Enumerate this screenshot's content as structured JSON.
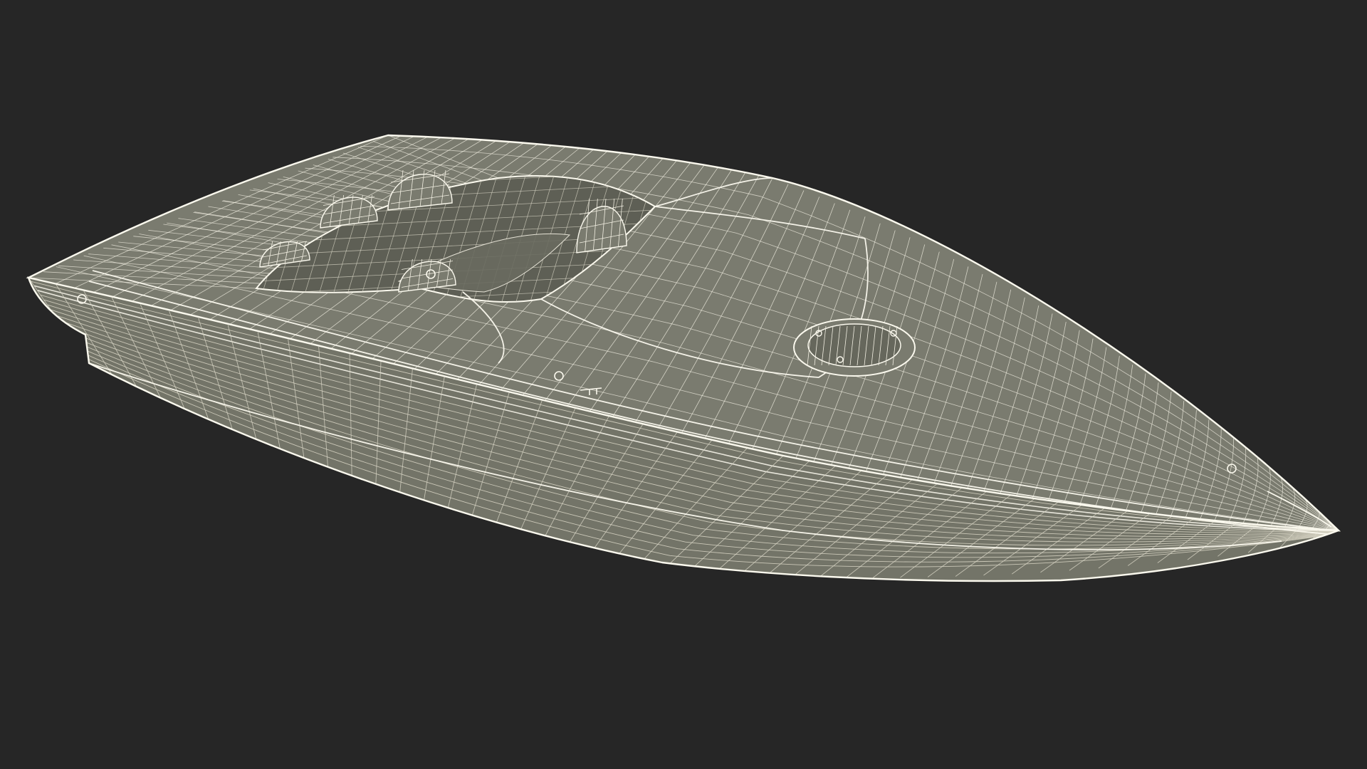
{
  "scene": {
    "background_color": "#262626",
    "subject": "speedboat-wireframe-model",
    "render_style": "wireframe-over-solid"
  },
  "colors": {
    "hull_fill": "#737468",
    "hull_shadow": "#66675c",
    "deck_fill": "#7a7b6f",
    "cockpit_fill": "#5e5f55",
    "cockpit_floor": "#6a6b60",
    "wire": "#f4f1e4",
    "wire_dim": "#d9d6c6",
    "edge": "#fbf9ee"
  },
  "icons": {
    "hatch": "deck-hatch-icon",
    "cleat": "bow-cleat-icon"
  }
}
